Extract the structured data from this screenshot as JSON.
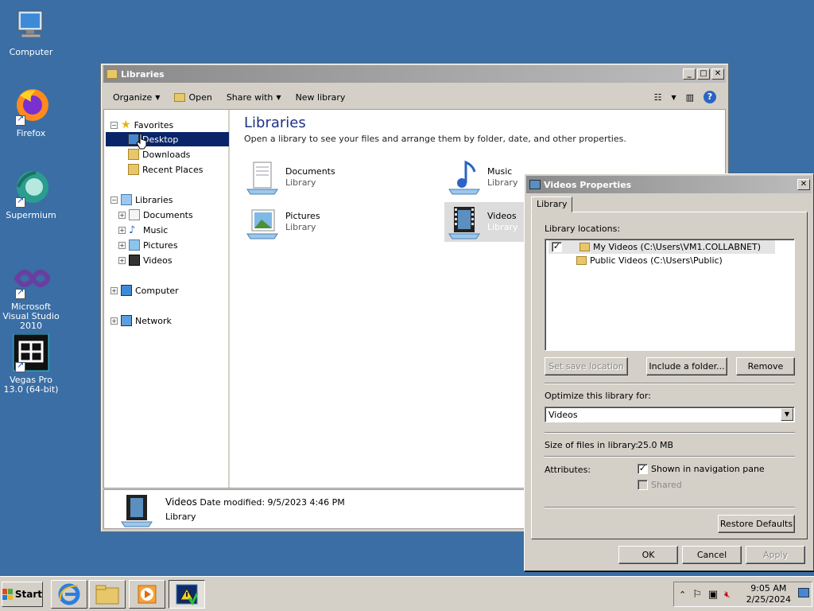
{
  "desktop": {
    "icons": [
      {
        "label": "Computer"
      },
      {
        "label": "Firefox"
      },
      {
        "label": "Supermium"
      },
      {
        "label": "Microsoft Visual Studio 2010"
      },
      {
        "label": "Vegas Pro 13.0 (64-bit)"
      }
    ]
  },
  "explorer": {
    "title": "Libraries",
    "toolbar": {
      "organize": "Organize",
      "open": "Open",
      "share_with": "Share with",
      "new_library": "New library"
    },
    "nav": {
      "favorites": "Favorites",
      "desktop": "Desktop",
      "downloads": "Downloads",
      "recent_places": "Recent Places",
      "libraries": "Libraries",
      "documents": "Documents",
      "music": "Music",
      "pictures": "Pictures",
      "videos": "Videos",
      "computer": "Computer",
      "network": "Network"
    },
    "content": {
      "heading": "Libraries",
      "subtitle": "Open a library to see your files and arrange them by folder, date, and other properties.",
      "items": [
        {
          "name": "Documents",
          "kind": "Library"
        },
        {
          "name": "Music",
          "kind": "Library"
        },
        {
          "name": "Pictures",
          "kind": "Library"
        },
        {
          "name": "Videos",
          "kind": "Library"
        }
      ]
    },
    "details": {
      "name": "Videos",
      "modified_label": "Date modified:",
      "modified_value": "9/5/2023 4:46 PM",
      "kind": "Library"
    }
  },
  "dialog": {
    "title": "Videos Properties",
    "tab": "Library",
    "locations_label": "Library locations:",
    "locations": [
      {
        "text": "My Videos (C:\\Users\\VM1.COLLABNET)",
        "checked": true
      },
      {
        "text": "Public Videos (C:\\Users\\Public)"
      }
    ],
    "set_save_location": "Set save location",
    "include_folder": "Include a folder...",
    "remove": "Remove",
    "optimize_label": "Optimize this library for:",
    "optimize_value": "Videos",
    "size_label": "Size of files in library:",
    "size_value": "25.0 MB",
    "attributes_label": "Attributes:",
    "shown_in_nav": "Shown in navigation pane",
    "shared": "Shared",
    "restore_defaults": "Restore Defaults",
    "ok": "OK",
    "cancel": "Cancel",
    "apply": "Apply"
  },
  "taskbar": {
    "start": "Start",
    "time": "9:05 AM",
    "date": "2/25/2024"
  }
}
